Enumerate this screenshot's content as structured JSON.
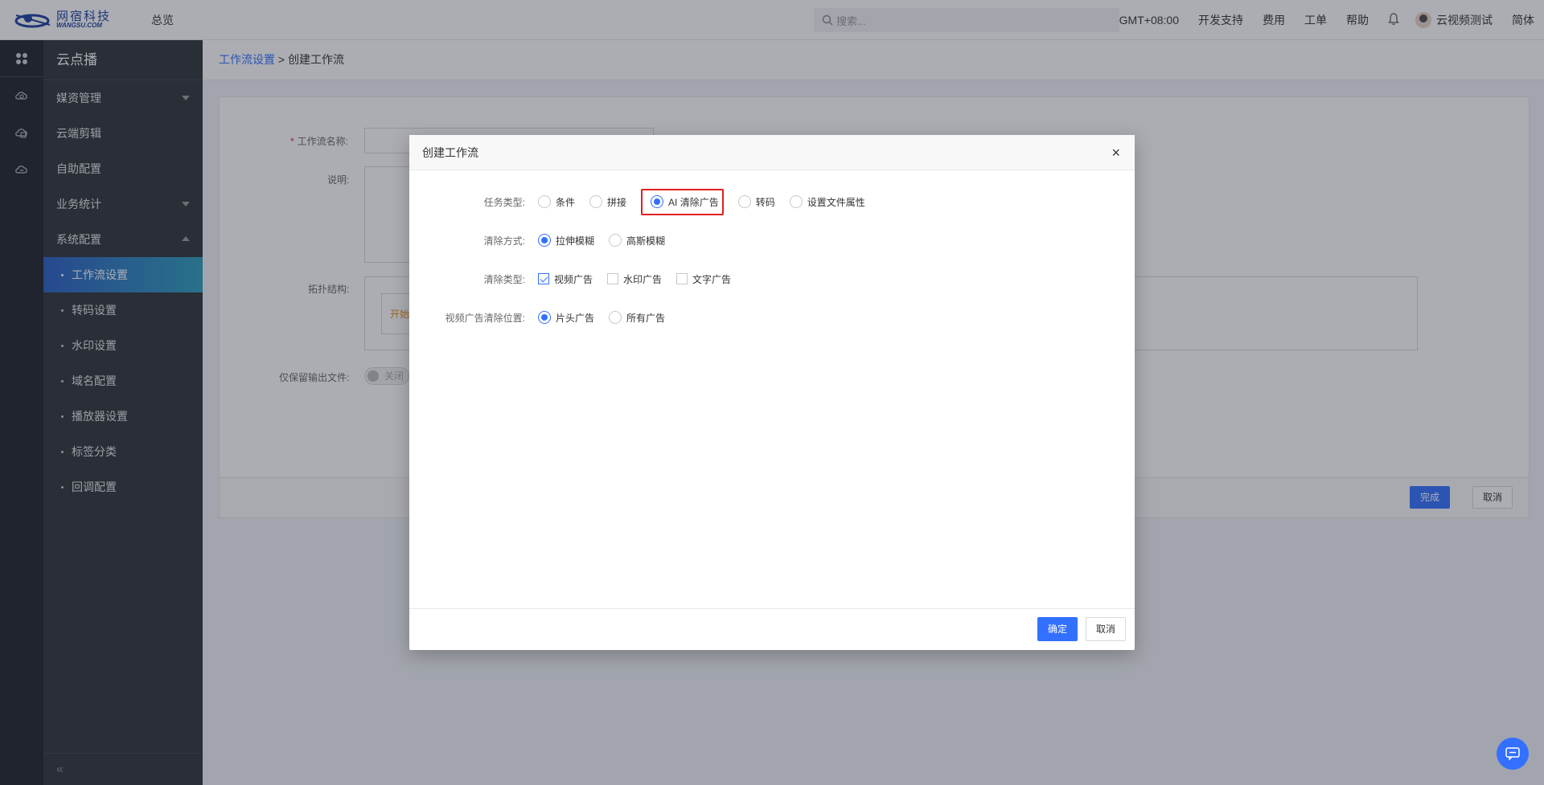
{
  "topbar": {
    "logo_cn": "网宿科技",
    "logo_en": "WANGSU.COM",
    "overview": "总览",
    "search_placeholder": "搜索...",
    "timezone": "GMT+08:00",
    "dev_support": "开发支持",
    "fees": "费用",
    "tickets": "工单",
    "help": "帮助",
    "username": "云视频测试",
    "language": "简体"
  },
  "sidebar": {
    "title": "云点播",
    "items": [
      {
        "label": "媒资管理"
      },
      {
        "label": "云端剪辑"
      },
      {
        "label": "自助配置"
      },
      {
        "label": "业务统计"
      },
      {
        "label": "系统配置"
      }
    ],
    "subitems": [
      {
        "label": "工作流设置"
      },
      {
        "label": "转码设置"
      },
      {
        "label": "水印设置"
      },
      {
        "label": "域名配置"
      },
      {
        "label": "播放器设置"
      },
      {
        "label": "标签分类"
      },
      {
        "label": "回调配置"
      }
    ],
    "collapse": "«"
  },
  "breadcrumb": {
    "parent": "工作流设置",
    "separator": " > ",
    "current": "创建工作流"
  },
  "form": {
    "name_label": "工作流名称:",
    "desc_label": "说明:",
    "topo_label": "拓扑结构:",
    "start_node": "开始",
    "keep_output_label": "仅保留输出文件:",
    "toggle_text": "关闭",
    "finish_button": "完成",
    "cancel_button": "取消"
  },
  "modal": {
    "title": "创建工作流",
    "close": "×",
    "task_type_label": "任务类型:",
    "task_types": [
      "条件",
      "拼接",
      "AI 清除广告",
      "转码",
      "设置文件属性"
    ],
    "task_type_selected": "AI 清除广告",
    "clear_method_label": "清除方式:",
    "clear_methods": [
      "拉伸模糊",
      "高斯模糊"
    ],
    "clear_method_selected": "拉伸模糊",
    "clear_type_label": "清除类型:",
    "clear_types": [
      "视频广告",
      "水印广告",
      "文字广告"
    ],
    "clear_types_checked": [
      "视频广告"
    ],
    "position_label": "视频广告清除位置:",
    "positions": [
      "片头广告",
      "所有广告"
    ],
    "position_selected": "片头广告",
    "ok_button": "确定",
    "cancel_button": "取消"
  }
}
